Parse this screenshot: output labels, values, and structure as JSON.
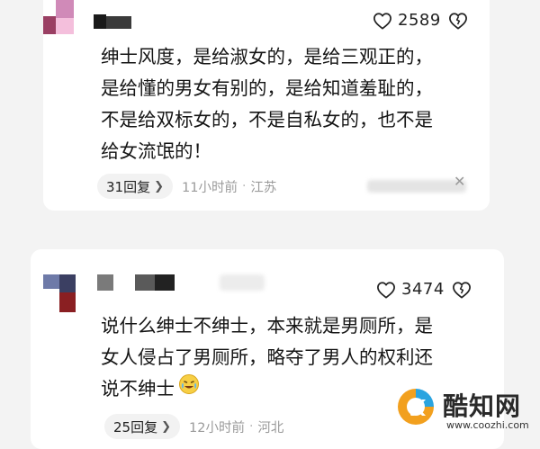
{
  "comments": [
    {
      "likes": "2589",
      "text_lines": [
        "绅士风度，是给淑女的，是给三观正的，",
        "是给懂的男女有别的，是给知道羞耻的，",
        "不是给双标女的，不是自私女的，也不是",
        "给女流氓的！"
      ],
      "replies_label": "31回复",
      "time": "11小时前",
      "dot": "·",
      "location": "江苏"
    },
    {
      "likes": "3474",
      "text_lines": [
        "说什么绅士不绅士，本来就是男厕所，是",
        "女人侵占了男厕所，略夺了男人的权利还",
        "说不绅士"
      ],
      "replies_label": "25回复",
      "time": "12小时前",
      "dot": "·",
      "location": "河北"
    }
  ],
  "watermark": {
    "title": "酷知网",
    "url": "www.coozhi.com"
  },
  "colors": {
    "avatar1": [
      "#d08ab8",
      "#f4bfdc",
      "#9a3f63"
    ],
    "avatar2": [
      "#6e7aa8",
      "#8a1f22",
      "#5c1b1b"
    ],
    "logo_orange": "#f2a01e",
    "logo_blue": "#2aa4e0"
  },
  "icons": {
    "like": "heart-outline-icon",
    "dislike": "broken-heart-icon",
    "reply_arrow": "chevron-right-icon",
    "close": "close-icon",
    "emoji": "crying-laughing-emoji-icon"
  }
}
